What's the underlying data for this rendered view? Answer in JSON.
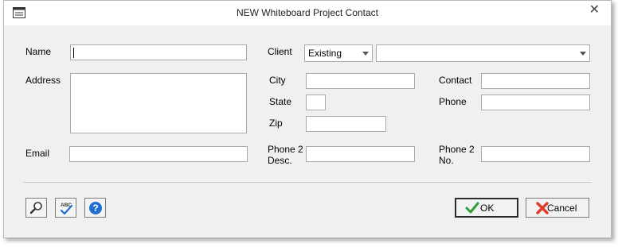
{
  "window": {
    "title": "NEW Whiteboard Project Contact",
    "close_glyph": "✕"
  },
  "form": {
    "name_label": "Name",
    "name_value": "",
    "address_label": "Address",
    "address_value": "",
    "email_label": "Email",
    "email_value": "",
    "client_label": "Client",
    "client_type_selected": "Existing",
    "client_selected": "",
    "city_label": "City",
    "state_label": "State",
    "zip_label": "Zip",
    "phone2_desc_label_line1": "Phone 2",
    "phone2_desc_label_line2": "Desc.",
    "contact_label": "Contact",
    "phone_label": "Phone",
    "phone2_no_label_line1": "Phone 2",
    "phone2_no_label_line2": "No."
  },
  "footer": {
    "ok_label": "OK",
    "cancel_label": "Cancel",
    "spell_icon_text": "ABC",
    "icons": [
      "search-icon",
      "spellcheck-icon",
      "help-icon"
    ]
  },
  "colors": {
    "ok_border": "#2b2b2b",
    "ok_check": "#2e9e3a",
    "cancel_x": "#e03a2a",
    "help_blue": "#1f6fd0"
  }
}
